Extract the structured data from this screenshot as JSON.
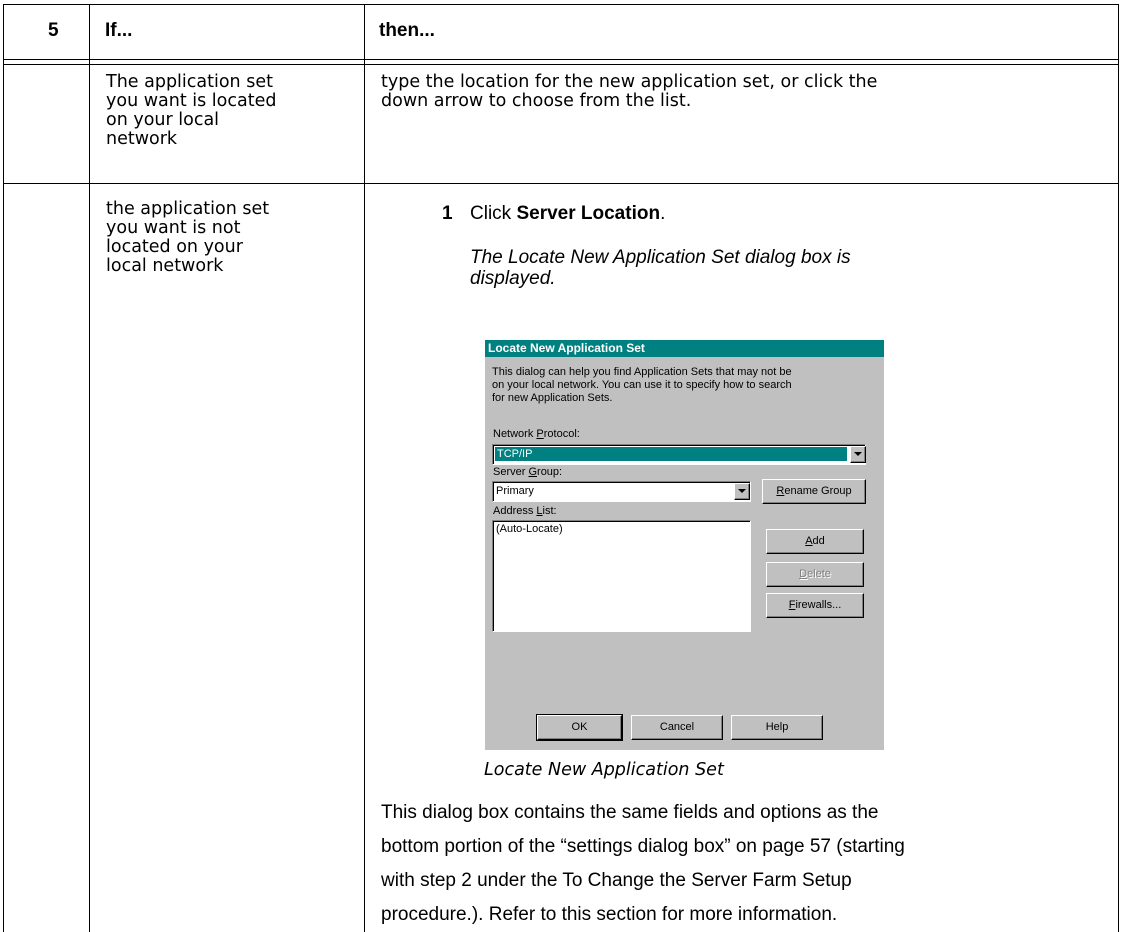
{
  "table": {
    "header": {
      "step": "5",
      "if": "If...",
      "then": "then..."
    },
    "rows": [
      {
        "condition": [
          "The application set",
          "you want is located",
          "on your local",
          "network"
        ],
        "action": [
          "type the location for the new application set, or click the",
          "down arrow to choose from the list."
        ]
      },
      {
        "condition": [
          "the application set",
          "you want is not",
          "located on your",
          "local network"
        ],
        "step_number": "1",
        "step_text_prefix": "Click ",
        "step_text_bold": "Server Location",
        "step_text_suffix": ".",
        "result": [
          "The Locate New Application Set dialog box is",
          "displayed."
        ],
        "caption": "Locate New Application Set",
        "body": [
          "This dialog box contains the same fields and options as the",
          "bottom portion of the “settings dialog box” on page 57 (starting",
          "with step 2 under the To Change the Server Farm Setup",
          "procedure.). Refer to this section for more information."
        ]
      }
    ]
  },
  "dialog": {
    "title": "Locate New Application Set",
    "description": [
      "This dialog can help you find Application Sets that may not be",
      "on your local network.  You can use it to specify how to search",
      "for new Application Sets."
    ],
    "protocol_label_pre": "Network ",
    "protocol_label_u": "P",
    "protocol_label_post": "rotocol:",
    "protocol_value": "TCP/IP",
    "group_label_pre": "Server ",
    "group_label_u": "G",
    "group_label_post": "roup:",
    "group_value": "Primary",
    "rename_u": "R",
    "rename_rest": "ename Group",
    "address_label_pre": "Address ",
    "address_label_u": "L",
    "address_label_post": "ist:",
    "address_items": [
      "(Auto-Locate)"
    ],
    "add_u": "A",
    "add_rest": "dd",
    "delete_u": "D",
    "delete_rest": "elete",
    "firewalls_u": "F",
    "firewalls_rest": "irewalls...",
    "ok": "OK",
    "cancel": "Cancel",
    "help": "Help",
    "colors": {
      "title_bar": "#008080",
      "face": "#c0c0c0",
      "selection": "#008080"
    }
  }
}
